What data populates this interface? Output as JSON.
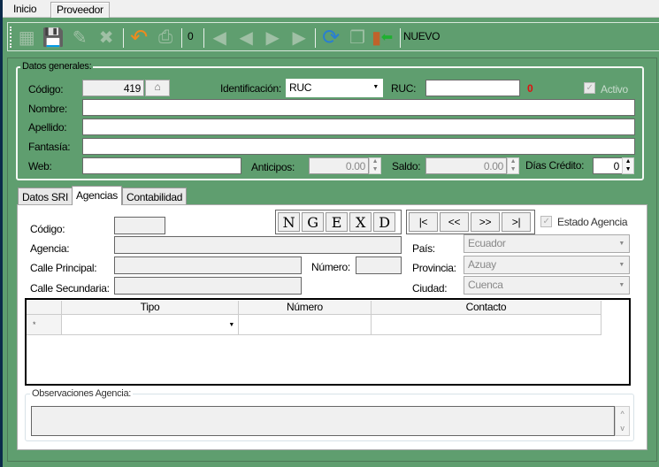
{
  "tabs": [
    "Inicio",
    "Proveedor"
  ],
  "toolbar": {
    "counter": "0",
    "mode": "NUEVO",
    "icons": [
      "new-icon",
      "save-icon",
      "edit-icon",
      "delete-icon",
      "undo-icon",
      "print-icon",
      "first-icon",
      "prev-icon",
      "next-icon",
      "last-icon",
      "refresh-icon",
      "copy-icon",
      "exit-icon"
    ]
  },
  "general": {
    "legend": "Datos generales:",
    "codigo_label": "Código:",
    "codigo": "419",
    "identificacion_label": "Identificación:",
    "identificacion": "RUC",
    "ruc_label": "RUC:",
    "ruc": "",
    "ruc_count": "0",
    "activo_label": "Activo",
    "nombre_label": "Nombre:",
    "apellido_label": "Apellido:",
    "fantasia_label": "Fantasía:",
    "web_label": "Web:",
    "anticipos_label": "Anticipos:",
    "anticipos": "0.00",
    "saldo_label": "Saldo:",
    "saldo": "0.00",
    "dias_label": "Días Crédito:",
    "dias": "0"
  },
  "subtabs": [
    "Datos SRI",
    "Agencias",
    "Contabilidad"
  ],
  "agencias": {
    "codigo_label": "Código:",
    "agencia_label": "Agencia:",
    "calle_principal_label": "Calle Principal:",
    "numero_label": "Número:",
    "calle_secundaria_label": "Calle Secundaria:",
    "action_buttons": [
      "N",
      "G",
      "E",
      "X",
      "D"
    ],
    "nav_buttons": [
      "|<",
      "<<",
      ">>",
      ">|"
    ],
    "estado_label": "Estado Agencia",
    "pais_label": "País:",
    "pais": "Ecuador",
    "provincia_label": "Provincia:",
    "provincia": "Azuay",
    "ciudad_label": "Ciudad:",
    "ciudad": "Cuenca",
    "grid": {
      "columns": [
        "Tipo",
        "Número",
        "Contacto"
      ],
      "row_marker": "*"
    },
    "observaciones_label": "Observaciones Agencia:"
  }
}
